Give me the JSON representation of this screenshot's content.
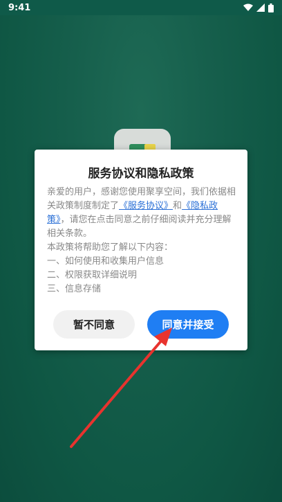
{
  "status_bar": {
    "time": "9:41"
  },
  "dialog": {
    "title": "服务协议和隐私政策",
    "body": {
      "intro_prefix": "亲爱的用户，感谢您使用聚享空间，我们依据相关政策制度制定了",
      "service_agreement_link": "《服务协议》",
      "conjunction": "和",
      "privacy_policy_link": "《隐私政策》",
      "intro_suffix": "，请您在点击同意之前仔细阅读并充分理解相关条款。",
      "help_line": "本政策将帮助您了解以下内容：",
      "items": [
        "一、如何使用和收集用户信息",
        "二、权限获取详细说明",
        "三、信息存储"
      ]
    },
    "decline_label": "暂不同意",
    "accept_label": "同意并接受"
  },
  "colors": {
    "background": "#0f5a49",
    "accent": "#1f7ef3",
    "link": "#2a6fd6",
    "arrow": "#e8332e"
  },
  "icons": [
    "wifi-icon",
    "signal-icon",
    "battery-icon",
    "app-logo-icon"
  ]
}
